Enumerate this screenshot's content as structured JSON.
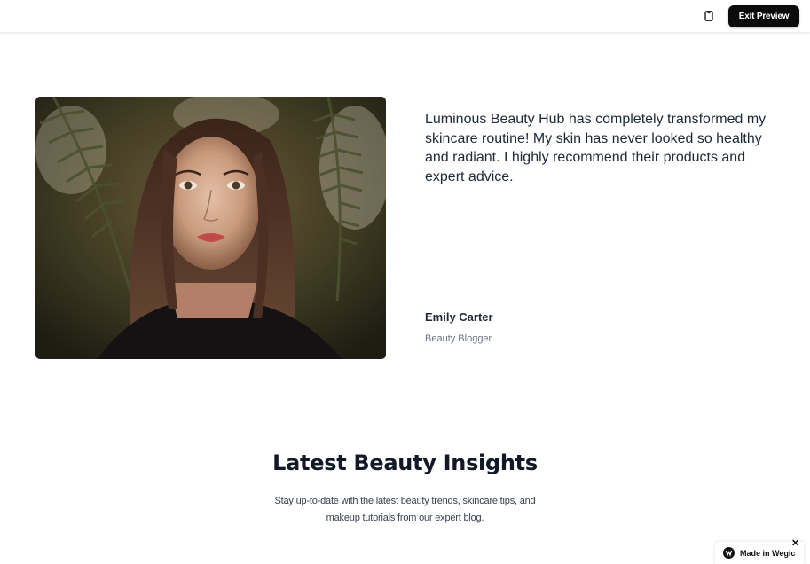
{
  "toolbar": {
    "device_icon": "mobile-device-icon",
    "exit_label": "Exit Preview"
  },
  "testimonial": {
    "image_alt": "portrait-photo",
    "quote": "Luminous Beauty Hub has completely transformed my skincare routine! My skin has never looked so healthy and radiant. I highly recommend their products and expert advice.",
    "author_name": "Emily Carter",
    "author_role": "Beauty Blogger"
  },
  "blog_section": {
    "title": "Latest Beauty Insights",
    "subtitle": "Stay up-to-date with the latest beauty trends, skincare tips, and makeup tutorials from our expert blog."
  },
  "badge": {
    "label": "Made in Wegic",
    "close_symbol": "✕"
  },
  "colors": {
    "button_bg": "#0b0b0b",
    "text_primary": "#1f2937",
    "text_muted": "#6b7280"
  }
}
